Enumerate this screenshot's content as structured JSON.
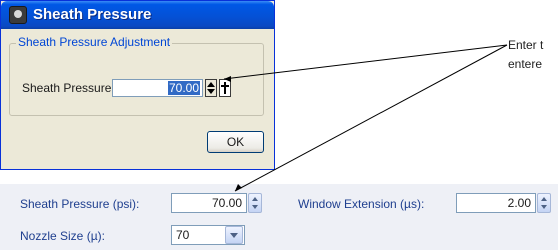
{
  "dialog": {
    "title": "Sheath Pressure",
    "group_label": "Sheath Pressure Adjustment",
    "field_label": "Sheath Pressure",
    "field_value": "70.00",
    "ok_label": "OK"
  },
  "callout": {
    "line1": "Enter t",
    "line2": "entere"
  },
  "panel": {
    "sheath_label": "Sheath Pressure (psi):",
    "sheath_value": "70.00",
    "window_label": "Window Extension (µs):",
    "window_value": "2.00",
    "nozzle_label": "Nozzle Size (µ):",
    "nozzle_value": "70"
  },
  "colors": {
    "titlebar": "#0451d6",
    "dialog_bg": "#ece9d8",
    "panel_label": "#1f3f8f",
    "group_label": "#0046d5"
  }
}
